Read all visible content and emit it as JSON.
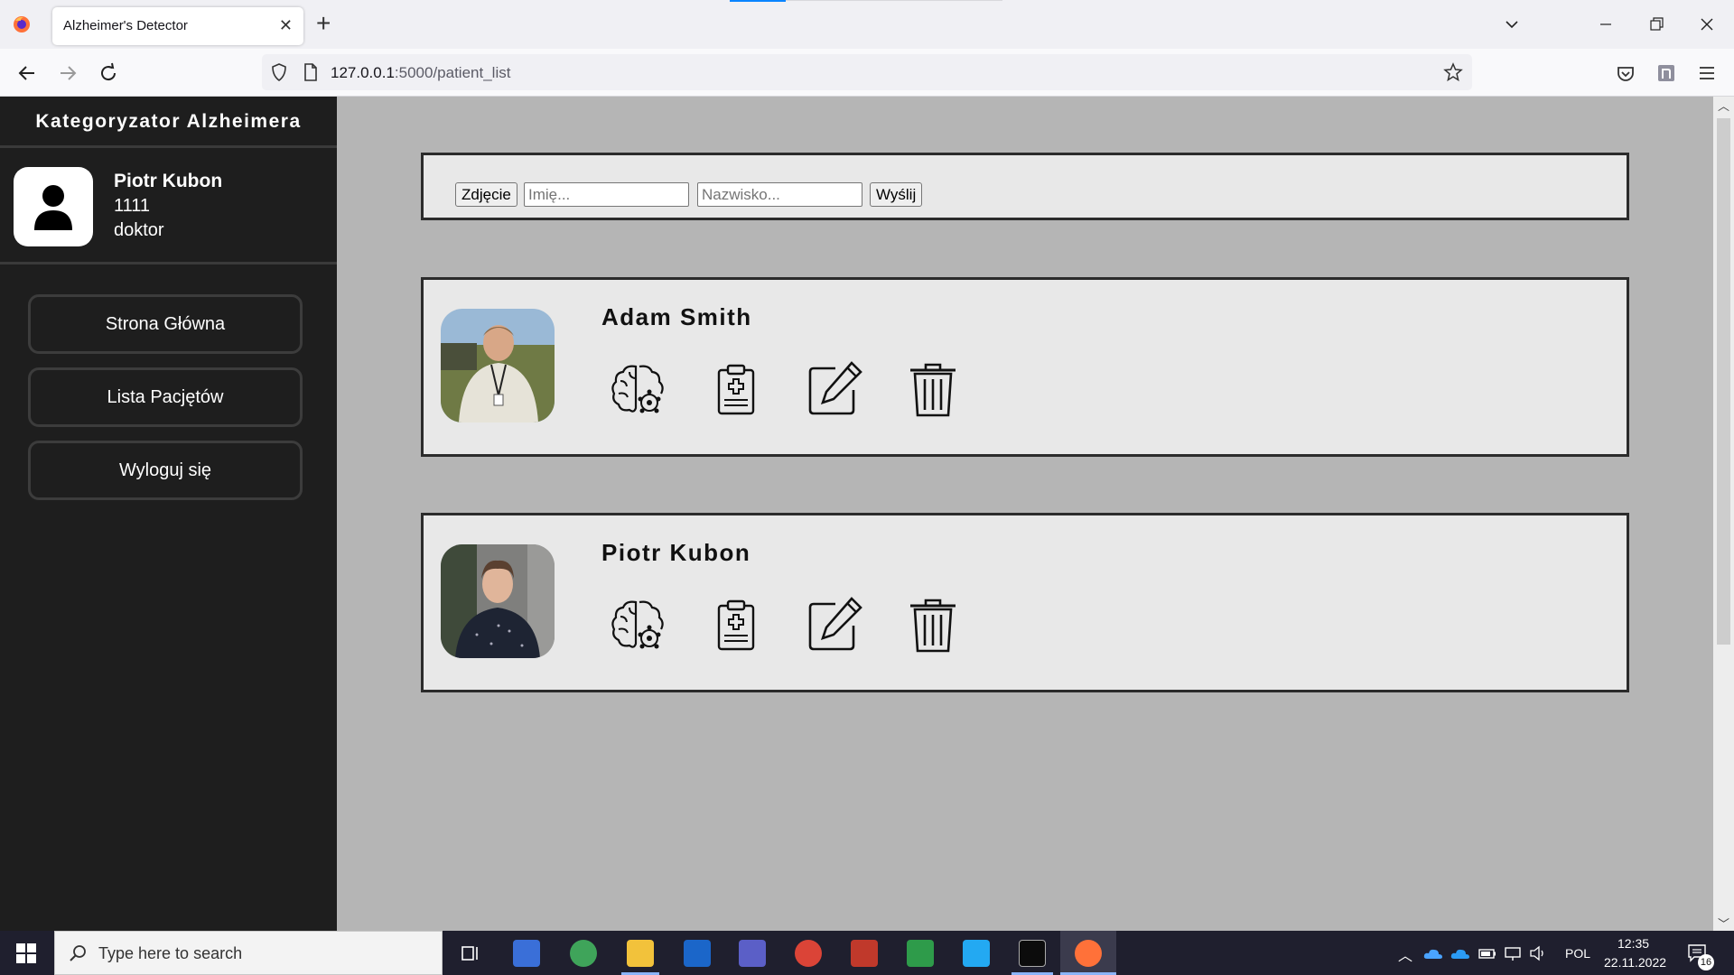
{
  "browser": {
    "tab_title": "Alzheimer's Detector",
    "tab_close": "✕",
    "new_tab": "+",
    "url_host": "127.0.0.1",
    "url_path": ":5000/patient_list"
  },
  "sidebar": {
    "title": "Kategoryzator Alzheimera",
    "user": {
      "name": "Piotr Kubon",
      "id": "1111",
      "role": "doktor"
    },
    "menu": [
      {
        "label": "Strona Główna"
      },
      {
        "label": "Lista Pacjętów"
      },
      {
        "label": "Wyloguj się"
      }
    ]
  },
  "form": {
    "photo_button": "Zdjęcie",
    "first_name_placeholder": "Imię...",
    "last_name_placeholder": "Nazwisko...",
    "submit_button": "Wyślij"
  },
  "patients": [
    {
      "name": "Adam Smith"
    },
    {
      "name": "Piotr Kubon"
    }
  ],
  "taskbar": {
    "search_placeholder": "Type here to search",
    "language": "POL",
    "time": "12:35",
    "date": "22.11.2022",
    "notifications": "16"
  },
  "icons": {
    "brain": "brain-icon",
    "clipboard": "clipboard-medical-icon",
    "edit": "edit-icon",
    "trash": "trash-icon"
  }
}
